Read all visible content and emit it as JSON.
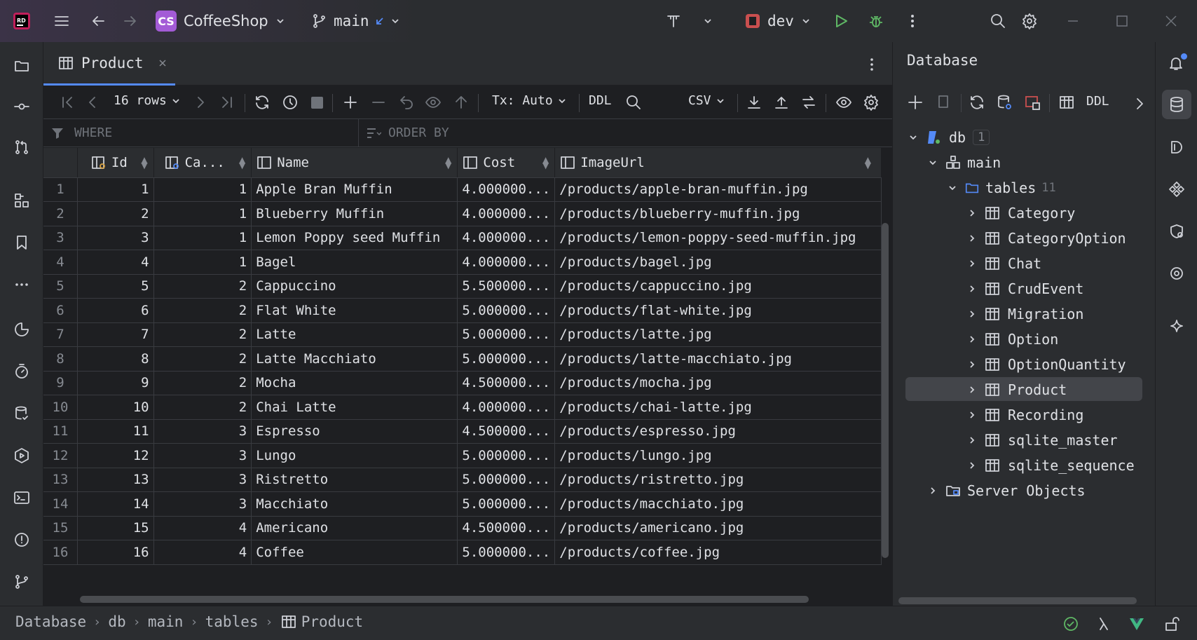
{
  "titlebar": {
    "project_initials": "CS",
    "project_name": "CoffeeShop",
    "branch": "main",
    "run_config": "dev"
  },
  "editor": {
    "tab_label": "Product",
    "toolbar": {
      "rows_label": "16 rows",
      "tx_label": "Tx: Auto",
      "ddl_label": "DDL",
      "export_format": "CSV"
    },
    "filter": {
      "where_placeholder": "WHERE",
      "orderby_placeholder": "ORDER BY"
    },
    "columns": [
      "Id",
      "Ca...",
      "Name",
      "Cost",
      "ImageUrl"
    ],
    "rows": [
      {
        "n": "1",
        "id": "1",
        "cat": "1",
        "name": "Apple Bran Muffin",
        "cost": "4.000000...",
        "url": "/products/apple-bran-muffin.jpg"
      },
      {
        "n": "2",
        "id": "2",
        "cat": "1",
        "name": "Blueberry Muffin",
        "cost": "4.000000...",
        "url": "/products/blueberry-muffin.jpg"
      },
      {
        "n": "3",
        "id": "3",
        "cat": "1",
        "name": "Lemon Poppy seed Muffin",
        "cost": "4.000000...",
        "url": "/products/lemon-poppy-seed-muffin.jpg"
      },
      {
        "n": "4",
        "id": "4",
        "cat": "1",
        "name": "Bagel",
        "cost": "4.000000...",
        "url": "/products/bagel.jpg"
      },
      {
        "n": "5",
        "id": "5",
        "cat": "2",
        "name": "Cappuccino",
        "cost": "5.500000...",
        "url": "/products/cappuccino.jpg"
      },
      {
        "n": "6",
        "id": "6",
        "cat": "2",
        "name": "Flat White",
        "cost": "5.000000...",
        "url": "/products/flat-white.jpg"
      },
      {
        "n": "7",
        "id": "7",
        "cat": "2",
        "name": "Latte",
        "cost": "5.000000...",
        "url": "/products/latte.jpg"
      },
      {
        "n": "8",
        "id": "8",
        "cat": "2",
        "name": "Latte Macchiato",
        "cost": "5.000000...",
        "url": "/products/latte-macchiato.jpg"
      },
      {
        "n": "9",
        "id": "9",
        "cat": "2",
        "name": "Mocha",
        "cost": "4.500000...",
        "url": "/products/mocha.jpg"
      },
      {
        "n": "10",
        "id": "10",
        "cat": "2",
        "name": "Chai Latte",
        "cost": "4.000000...",
        "url": "/products/chai-latte.jpg"
      },
      {
        "n": "11",
        "id": "11",
        "cat": "3",
        "name": "Espresso",
        "cost": "4.500000...",
        "url": "/products/espresso.jpg"
      },
      {
        "n": "12",
        "id": "12",
        "cat": "3",
        "name": "Lungo",
        "cost": "5.000000...",
        "url": "/products/lungo.jpg"
      },
      {
        "n": "13",
        "id": "13",
        "cat": "3",
        "name": "Ristretto",
        "cost": "5.000000...",
        "url": "/products/ristretto.jpg"
      },
      {
        "n": "14",
        "id": "14",
        "cat": "3",
        "name": "Macchiato",
        "cost": "5.000000...",
        "url": "/products/macchiato.jpg"
      },
      {
        "n": "15",
        "id": "15",
        "cat": "4",
        "name": "Americano",
        "cost": "4.500000...",
        "url": "/products/americano.jpg"
      },
      {
        "n": "16",
        "id": "16",
        "cat": "4",
        "name": "Coffee",
        "cost": "5.000000...",
        "url": "/products/coffee.jpg"
      }
    ]
  },
  "database": {
    "title": "Database",
    "ddl_label": "DDL",
    "db_name": "db",
    "db_badge": "1",
    "schema": "main",
    "tables_label": "tables",
    "tables_count": "11",
    "tables": [
      "Category",
      "CategoryOption",
      "Chat",
      "CrudEvent",
      "Migration",
      "Option",
      "OptionQuantity",
      "Product",
      "Recording",
      "sqlite_master",
      "sqlite_sequence"
    ],
    "server_objects": "Server Objects"
  },
  "statusbar": {
    "crumbs": [
      "Database",
      "db",
      "main",
      "tables",
      "Product"
    ]
  },
  "colors": {
    "accent": "#548af7",
    "run_green": "#5fb865",
    "selection": "#43454a"
  }
}
